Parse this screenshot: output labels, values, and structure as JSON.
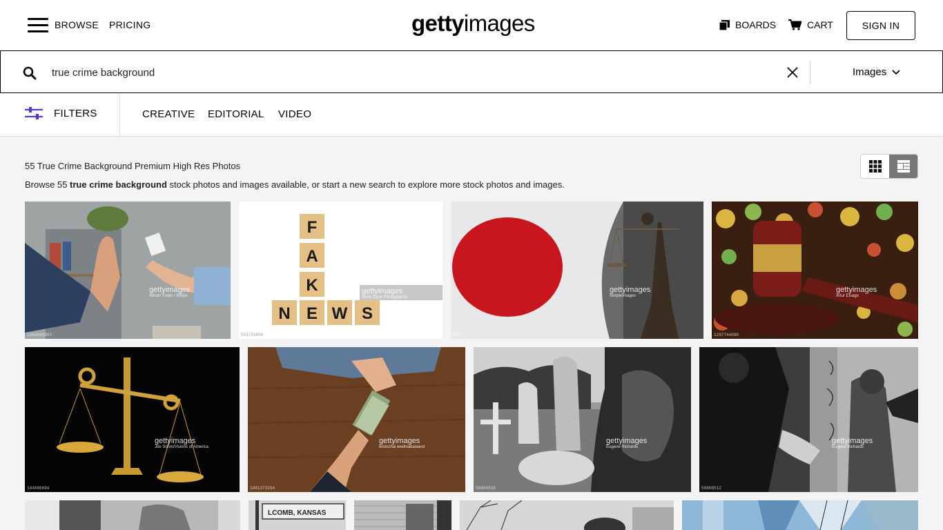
{
  "header": {
    "browse": "BROWSE",
    "pricing": "PRICING",
    "logo_bold": "getty",
    "logo_light": "images",
    "boards": "BOARDS",
    "cart": "CART",
    "sign_in": "SIGN IN"
  },
  "search": {
    "value": "true crime background",
    "type": "Images"
  },
  "filterbar": {
    "filters": "FILTERS",
    "tabs": [
      "CREATIVE",
      "EDITORIAL",
      "VIDEO"
    ]
  },
  "results": {
    "title": "55 True Crime Background Premium High Res Photos",
    "sub_before": "Browse 55 ",
    "sub_bold": "true crime background",
    "sub_after": " stock photos and images available, or start a new search to explore more stock photos and images."
  },
  "images": [
    {
      "credit": "Adrian Tudor / 500px",
      "id": "1364049863"
    },
    {
      "credit": "Anne Curie Photography",
      "id": "501759806"
    },
    {
      "credit": "SimpleImages",
      "id": "7021"
    },
    {
      "credit": "Artur Elsago",
      "id": "1297744090"
    },
    {
      "credit": "Joe Sohm/Visions of America",
      "id": "144086094"
    },
    {
      "credit": "boonchai wedmakawand",
      "id": "1081373334"
    },
    {
      "credit": "Eugene Richards",
      "id": "50808510"
    },
    {
      "credit": "Eugene Richards",
      "id": "50808512"
    }
  ],
  "watermark": "gettyimages",
  "colors": {
    "accent_purple": "#5b37c8",
    "view_toggle_active": "#777777"
  }
}
